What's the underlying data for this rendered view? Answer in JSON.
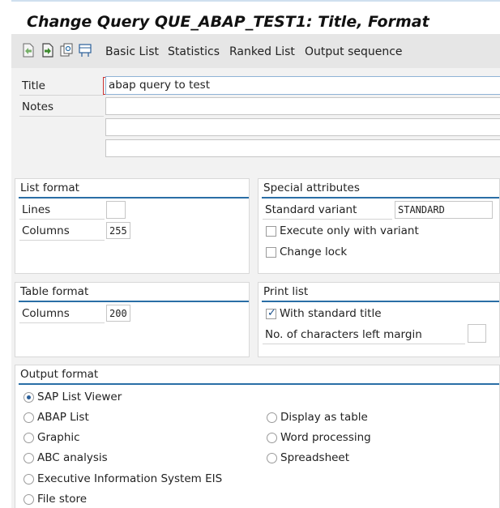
{
  "window": {
    "title": "Change Query QUE_ABAP_TEST1: Title, Format"
  },
  "toolbar": {
    "icons": [
      "previous-screen-icon",
      "next-screen-icon",
      "copy-icon",
      "layout-icon"
    ],
    "basic_list": "Basic List",
    "statistics": "Statistics",
    "ranked_list": "Ranked List",
    "output_sequence": "Output sequence"
  },
  "header_fields": {
    "title_label": "Title",
    "title_value": "abap query to test",
    "notes_label": "Notes",
    "notes_lines": [
      "",
      "",
      ""
    ]
  },
  "list_format": {
    "title": "List format",
    "lines_label": "Lines",
    "lines_value": "",
    "columns_label": "Columns",
    "columns_value": "255"
  },
  "special_attributes": {
    "title": "Special attributes",
    "standard_variant_label": "Standard variant",
    "standard_variant_value": "STANDARD",
    "execute_only_label": "Execute only with variant",
    "execute_only_checked": false,
    "change_lock_label": "Change lock",
    "change_lock_checked": false
  },
  "table_format": {
    "title": "Table format",
    "columns_label": "Columns",
    "columns_value": "200"
  },
  "print_list": {
    "title": "Print list",
    "standard_title_label": "With standard title",
    "standard_title_checked": true,
    "left_margin_label": "No. of characters left margin",
    "left_margin_value": ""
  },
  "output_format": {
    "title": "Output format",
    "selected": "SAP List Viewer",
    "options_left": [
      "SAP List Viewer",
      "ABAP List",
      "Graphic",
      "ABC analysis",
      "Executive Information System EIS",
      "File store"
    ],
    "options_right": [
      "Display as table",
      "Word processing",
      "Spreadsheet"
    ]
  },
  "colors": {
    "accent": "#2a6ea6",
    "toolbar_bg": "#e6e6e6",
    "panel_bg": "#f2f2f2"
  }
}
